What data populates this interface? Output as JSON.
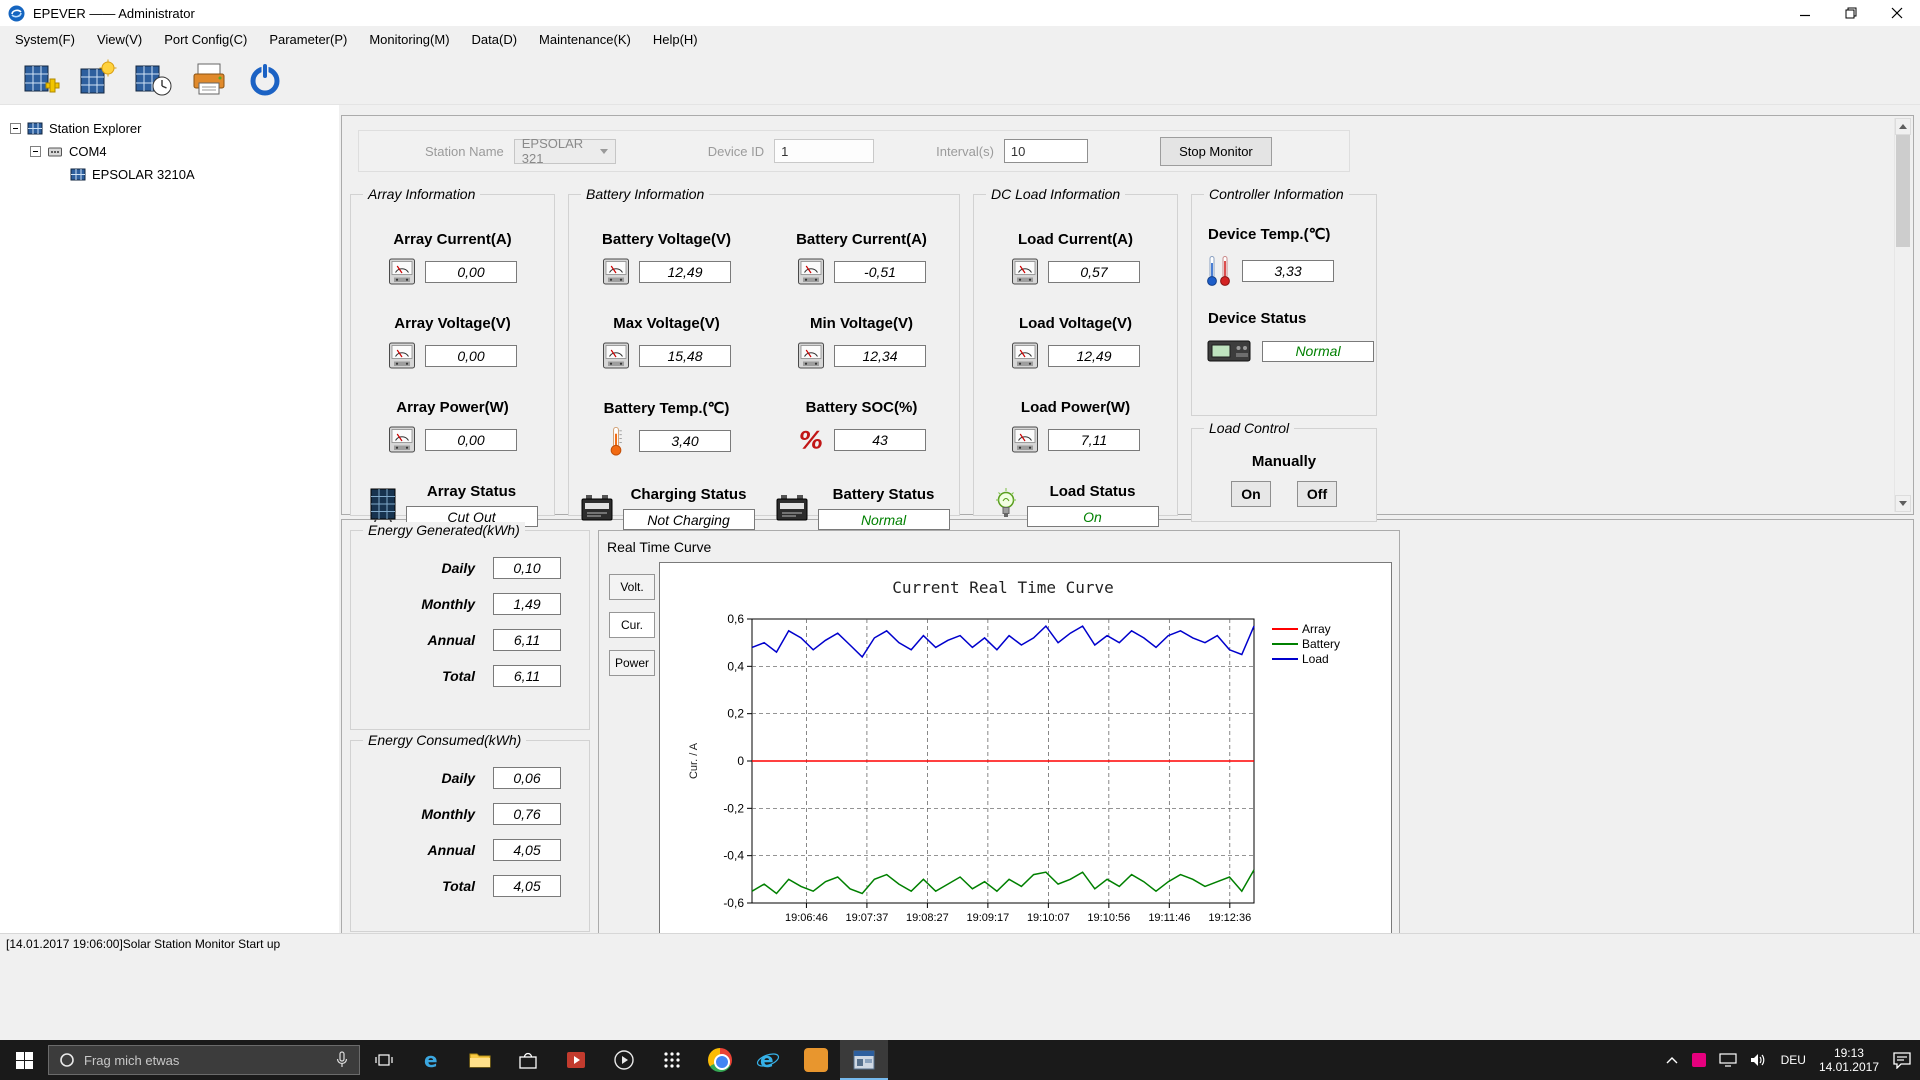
{
  "window": {
    "title": "EPEVER —— Administrator"
  },
  "menu": {
    "items": [
      "System(F)",
      "View(V)",
      "Port Config(C)",
      "Parameter(P)",
      "Monitoring(M)",
      "Data(D)",
      "Maintenance(K)",
      "Help(H)"
    ]
  },
  "tree": {
    "items": [
      {
        "label": "Station Explorer"
      },
      {
        "label": "COM4"
      },
      {
        "label": "EPSOLAR 3210A"
      }
    ]
  },
  "monitor_bar": {
    "station_name_label": "Station Name",
    "station_name_value": "EPSOLAR 321",
    "device_id_label": "Device ID",
    "device_id_value": "1",
    "interval_label": "Interval(s)",
    "interval_value": "10",
    "stop_button_label": "Stop Monitor"
  },
  "array_info": {
    "title": "Array Information",
    "metrics": [
      {
        "label": "Array Current(A)",
        "value": "0,00"
      },
      {
        "label": "Array Voltage(V)",
        "value": "0,00"
      },
      {
        "label": "Array Power(W)",
        "value": "0,00"
      }
    ],
    "status_label": "Array Status",
    "status_value": "Cut Out"
  },
  "battery_info": {
    "title": "Battery Information",
    "metrics": [
      {
        "label": "Battery Voltage(V)",
        "value": "12,49"
      },
      {
        "label": "Battery Current(A)",
        "value": "-0,51"
      },
      {
        "label": "Max Voltage(V)",
        "value": "15,48"
      },
      {
        "label": "Min Voltage(V)",
        "value": "12,34"
      },
      {
        "label": "Battery Temp.(℃)",
        "value": "3,40"
      },
      {
        "label": "Battery SOC(%)",
        "value": "43"
      }
    ],
    "charging_status_label": "Charging Status",
    "charging_status_value": "Not Charging",
    "battery_status_label": "Battery Status",
    "battery_status_value": "Normal"
  },
  "dc_load_info": {
    "title": "DC Load Information",
    "metrics": [
      {
        "label": "Load Current(A)",
        "value": "0,57"
      },
      {
        "label": "Load Voltage(V)",
        "value": "12,49"
      },
      {
        "label": "Load Power(W)",
        "value": "7,11"
      }
    ],
    "status_label": "Load Status",
    "status_value": "On"
  },
  "controller_info": {
    "title": "Controller Information",
    "temp_label": "Device Temp.(℃)",
    "temp_value": "3,33",
    "status_label": "Device Status",
    "status_value": "Normal"
  },
  "load_control": {
    "title": "Load Control",
    "mode_label": "Manually",
    "on_label": "On",
    "off_label": "Off"
  },
  "energy_generated": {
    "title": "Energy Generated(kWh)",
    "rows": [
      {
        "label": "Daily",
        "value": "0,10"
      },
      {
        "label": "Monthly",
        "value": "1,49"
      },
      {
        "label": "Annual",
        "value": "6,11"
      },
      {
        "label": "Total",
        "value": "6,11"
      }
    ]
  },
  "energy_consumed": {
    "title": "Energy Consumed(kWh)",
    "rows": [
      {
        "label": "Daily",
        "value": "0,06"
      },
      {
        "label": "Monthly",
        "value": "0,76"
      },
      {
        "label": "Annual",
        "value": "4,05"
      },
      {
        "label": "Total",
        "value": "4,05"
      }
    ]
  },
  "curve": {
    "panel_title": "Real Time Curve",
    "tabs": [
      "Volt.",
      "Cur.",
      "Power"
    ],
    "active_tab": "Cur."
  },
  "chart_data": {
    "type": "line",
    "title": "Current Real Time Curve",
    "ylabel": "Cur. / A",
    "ylim": [
      -0.6,
      0.6
    ],
    "y_ticks": [
      0.6,
      0.4,
      0.2,
      0,
      -0.2,
      -0.4,
      -0.6
    ],
    "y_tick_labels": [
      "0,6",
      "0,4",
      "0,2",
      "0",
      "-0,2",
      "-0,4",
      "-0,6"
    ],
    "x_tick_labels": [
      "19:06:46",
      "19:07:37",
      "19:08:27",
      "19:09:17",
      "19:10:07",
      "19:10:56",
      "19:11:46",
      "19:12:36"
    ],
    "grid": "dashed",
    "legend_position": "right",
    "series": [
      {
        "name": "Array",
        "color": "#ff0000",
        "values": [
          0,
          0,
          0,
          0,
          0,
          0,
          0,
          0,
          0,
          0,
          0,
          0,
          0,
          0,
          0,
          0,
          0,
          0,
          0,
          0,
          0,
          0,
          0,
          0,
          0,
          0,
          0,
          0,
          0,
          0,
          0,
          0,
          0,
          0,
          0,
          0,
          0,
          0,
          0,
          0,
          0,
          0
        ]
      },
      {
        "name": "Battery",
        "color": "#008000",
        "values": [
          -0.55,
          -0.52,
          -0.56,
          -0.5,
          -0.53,
          -0.55,
          -0.51,
          -0.49,
          -0.54,
          -0.56,
          -0.5,
          -0.48,
          -0.52,
          -0.55,
          -0.5,
          -0.55,
          -0.52,
          -0.49,
          -0.54,
          -0.51,
          -0.55,
          -0.5,
          -0.53,
          -0.48,
          -0.47,
          -0.52,
          -0.5,
          -0.47,
          -0.54,
          -0.5,
          -0.53,
          -0.48,
          -0.51,
          -0.55,
          -0.51,
          -0.48,
          -0.5,
          -0.53,
          -0.51,
          -0.49,
          -0.55,
          -0.46
        ]
      },
      {
        "name": "Load",
        "color": "#0000cc",
        "values": [
          0.48,
          0.5,
          0.46,
          0.55,
          0.52,
          0.47,
          0.51,
          0.54,
          0.49,
          0.44,
          0.52,
          0.55,
          0.5,
          0.47,
          0.53,
          0.48,
          0.51,
          0.53,
          0.48,
          0.52,
          0.47,
          0.53,
          0.49,
          0.52,
          0.57,
          0.5,
          0.54,
          0.57,
          0.49,
          0.53,
          0.5,
          0.55,
          0.52,
          0.48,
          0.53,
          0.55,
          0.52,
          0.5,
          0.53,
          0.47,
          0.45,
          0.57
        ]
      }
    ]
  },
  "status_bar": {
    "text": "[14.01.2017 19:06:00]Solar Station Monitor Start up"
  },
  "taskbar": {
    "search_placeholder": "Frag mich etwas",
    "language": "DEU",
    "time": "19:13",
    "date": "14.01.2017"
  },
  "colors": {
    "status_ok": "#008000",
    "accent": "#76b9ed"
  }
}
